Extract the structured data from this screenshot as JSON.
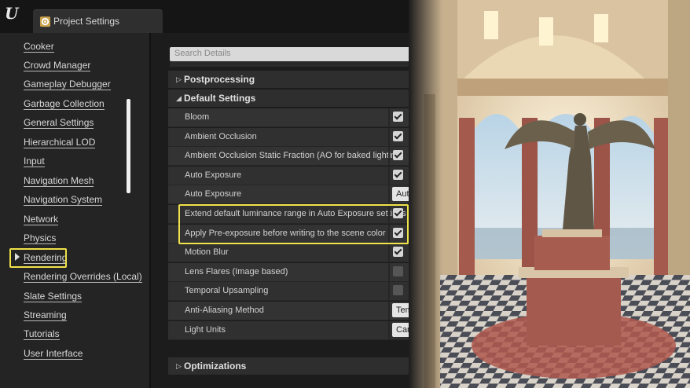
{
  "window": {
    "tab_label": "Project Settings",
    "logo_text": "U"
  },
  "sidebar": {
    "items": [
      {
        "label": "Cooker"
      },
      {
        "label": "Crowd Manager"
      },
      {
        "label": "Gameplay Debugger"
      },
      {
        "label": "Garbage Collection"
      },
      {
        "label": "General Settings"
      },
      {
        "label": "Hierarchical LOD"
      },
      {
        "label": "Input"
      },
      {
        "label": "Navigation Mesh"
      },
      {
        "label": "Navigation System"
      },
      {
        "label": "Network"
      },
      {
        "label": "Physics"
      },
      {
        "label": "Rendering",
        "selected": true
      },
      {
        "label": "Rendering Overrides (Local)"
      },
      {
        "label": "Slate Settings"
      },
      {
        "label": "Streaming"
      },
      {
        "label": "Tutorials"
      },
      {
        "label": "User Interface"
      }
    ]
  },
  "details": {
    "search_placeholder": "Search Details",
    "sections": {
      "postprocessing": {
        "label": "Postprocessing",
        "expanded": false
      },
      "default_settings": {
        "label": "Default Settings",
        "expanded": true
      },
      "optimizations": {
        "label": "Optimizations",
        "expanded": false
      }
    },
    "rows": [
      {
        "name": "Bloom",
        "type": "checkbox",
        "checked": true
      },
      {
        "name": "Ambient Occlusion",
        "type": "checkbox",
        "checked": true
      },
      {
        "name": "Ambient Occlusion Static Fraction (AO for baked lighting)",
        "type": "checkbox",
        "checked": true
      },
      {
        "name": "Auto Exposure",
        "type": "checkbox",
        "checked": true
      },
      {
        "name": "Auto Exposure",
        "type": "combo",
        "value": "Auto Exposure"
      },
      {
        "name": "Extend default luminance range in Auto Exposure settings",
        "type": "checkbox",
        "checked": true
      },
      {
        "name": "Apply Pre-exposure before writing to the scene color",
        "type": "checkbox",
        "checked": true
      },
      {
        "name": "Motion Blur",
        "type": "checkbox",
        "checked": true
      },
      {
        "name": "Lens Flares (Image based)",
        "type": "checkbox",
        "checked": false
      },
      {
        "name": "Temporal Upsampling",
        "type": "checkbox",
        "checked": false
      },
      {
        "name": "Anti-Aliasing Method",
        "type": "combo",
        "value": "TemporalAA"
      },
      {
        "name": "Light Units",
        "type": "combo",
        "value": "Candelas"
      }
    ]
  },
  "colors": {
    "highlight": "#f0e24a",
    "panel_bg": "#242424",
    "row_bg": "#333333"
  }
}
